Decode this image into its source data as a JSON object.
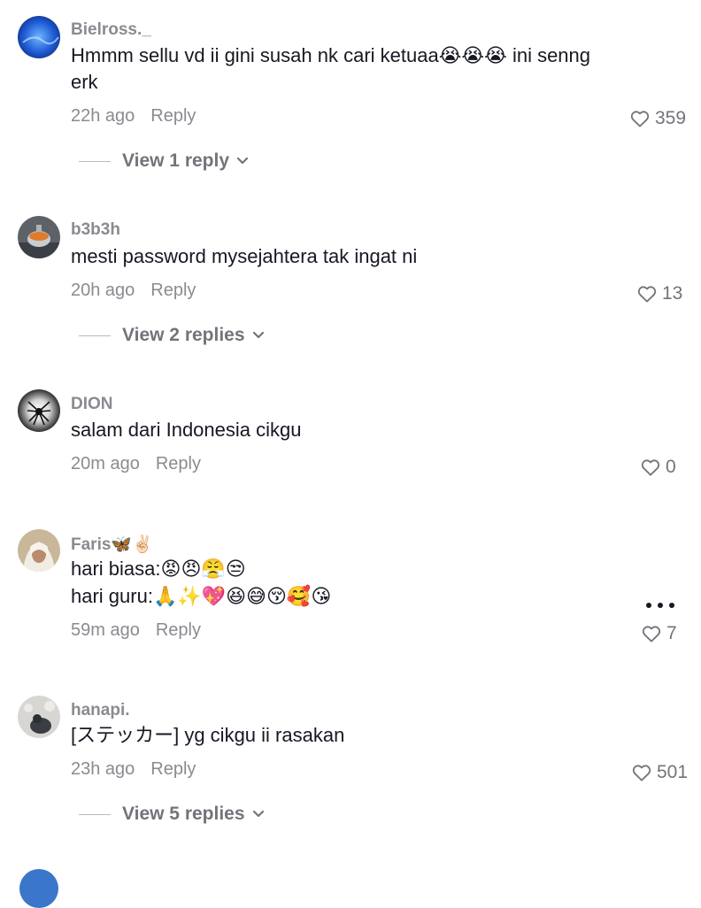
{
  "comments": [
    {
      "username": "Bielross._",
      "text": "Hmmm sellu vd ii gini susah nk cari ketuaa😭😭😭 ini senng erk",
      "time": "22h ago",
      "reply_label": "Reply",
      "likes": "359",
      "view_replies": "View 1 reply"
    },
    {
      "username": "b3b3h",
      "text": "mesti password mysejahtera tak ingat ni",
      "time": "20h ago",
      "reply_label": "Reply",
      "likes": "13",
      "view_replies": "View 2 replies"
    },
    {
      "username": "DION",
      "text": "salam dari Indonesia cikgu",
      "time": "20m ago",
      "reply_label": "Reply",
      "likes": "0"
    },
    {
      "username": "Faris🦋✌🏻",
      "line1": "hari biasa:😡😠😤😒",
      "line2": "hari guru:🙏✨💖😆😅😚🥰😘",
      "time": "59m ago",
      "reply_label": "Reply",
      "likes": "7"
    },
    {
      "username": "hanapi.",
      "text": "[ステッカー] yg cikgu ii rasakan",
      "time": "23h ago",
      "reply_label": "Reply",
      "likes": "501",
      "view_replies": "View 5 replies"
    }
  ],
  "icons": {
    "like": "heart-outline-icon",
    "expand": "chevron-down-icon",
    "more": "more-horizontal-icon"
  }
}
